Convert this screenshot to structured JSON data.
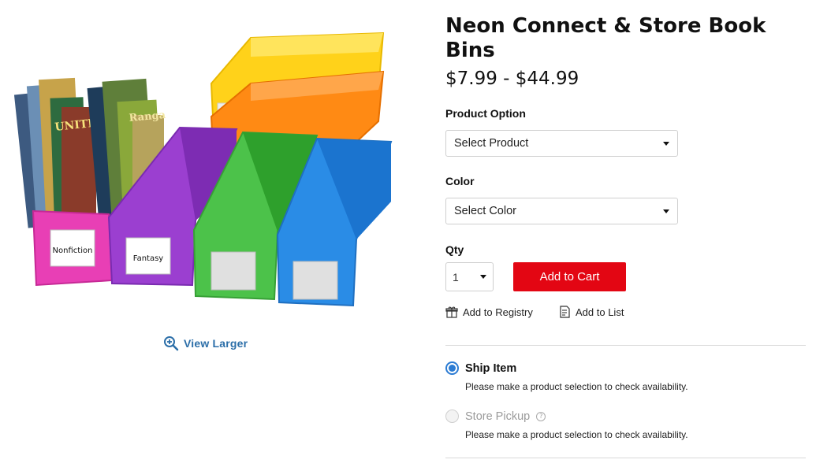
{
  "product": {
    "title": "Neon Connect & Store Book Bins",
    "price": "$7.99 - $44.99"
  },
  "gallery": {
    "view_larger_label": "View Larger",
    "bin_labels": [
      "Nonfiction",
      "Fantasy"
    ],
    "colors": {
      "pink": "#e83fb5",
      "purple": "#9b3fd0",
      "green": "#4cc24a",
      "blue": "#2a8ce6",
      "yellow": "#ffd21a",
      "orange": "#ff8a14"
    }
  },
  "options": {
    "product_option_label": "Product Option",
    "product_option_value": "Select Product",
    "color_label": "Color",
    "color_value": "Select Color",
    "qty_label": "Qty",
    "qty_value": "1"
  },
  "actions": {
    "add_to_cart": "Add to Cart",
    "add_to_registry": "Add to Registry",
    "add_to_list": "Add to List"
  },
  "fulfillment": {
    "ship_label": "Ship Item",
    "ship_note": "Please make a product selection to check availability.",
    "pickup_label": "Store Pickup",
    "pickup_note": "Please make a product selection to check availability."
  },
  "theme": {
    "accent": "#e30613",
    "link": "#2b6ea8",
    "radio": "#2b7bd3"
  }
}
